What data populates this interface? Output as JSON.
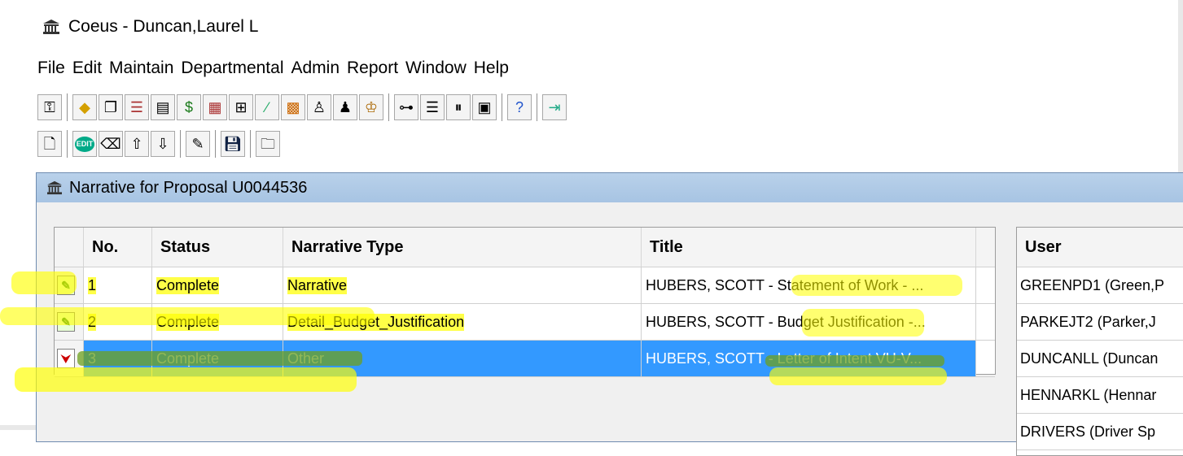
{
  "window": {
    "title": "Coeus -  Duncan,Laurel L"
  },
  "menu": [
    "File",
    "Edit",
    "Maintain",
    "Departmental",
    "Admin",
    "Report",
    "Window",
    "Help"
  ],
  "toolbar1": [
    "key-icon",
    "diamond-icon",
    "copy-icon",
    "budget-icon",
    "stack-icon",
    "money-icon",
    "cells-icon",
    "flow-icon",
    "chart-icon",
    "grid-icon",
    "person-icon",
    "people-icon",
    "org-icon",
    "tree-icon",
    "horizontal-icon",
    "vertical-icon",
    "calc-icon",
    "help-icon",
    "exit-icon"
  ],
  "toolbar2": [
    "doc-icon",
    "edit-icon",
    "eraser-icon",
    "up-arrow-icon",
    "down-arrow-icon",
    "write-icon",
    "save-icon",
    "folder-icon"
  ],
  "edit_label": "EDIT",
  "inner": {
    "title": "Narrative for Proposal  U0044536"
  },
  "table": {
    "headers": [
      "No.",
      "Status",
      "Narrative Type",
      "Title"
    ],
    "rows": [
      {
        "icon": "narrative-icon",
        "no": "1",
        "status": "Complete",
        "type": "Narrative",
        "title": "HUBERS, SCOTT - Statement of Work - ..."
      },
      {
        "icon": "narrative-icon",
        "no": "2",
        "status": "Complete",
        "type": "Detail_Budget_Justification",
        "title": "HUBERS, SCOTT - Budget Justification -..."
      },
      {
        "icon": "pdf-icon",
        "no": "3",
        "status": "Complete",
        "type": "Other",
        "title": "HUBERS, SCOTT - Letter of Intent VU-V..."
      }
    ]
  },
  "users": {
    "header": "User",
    "rows": [
      "GREENPD1 (Green,P",
      "PARKEJT2 (Parker,J",
      "DUNCANLL (Duncan",
      "HENNARKL (Hennar",
      "DRIVERS (Driver Sp"
    ]
  },
  "colors": {
    "selection": "#3399ff",
    "inner_title": "#b9d1ea",
    "highlight": "#ffff00"
  }
}
